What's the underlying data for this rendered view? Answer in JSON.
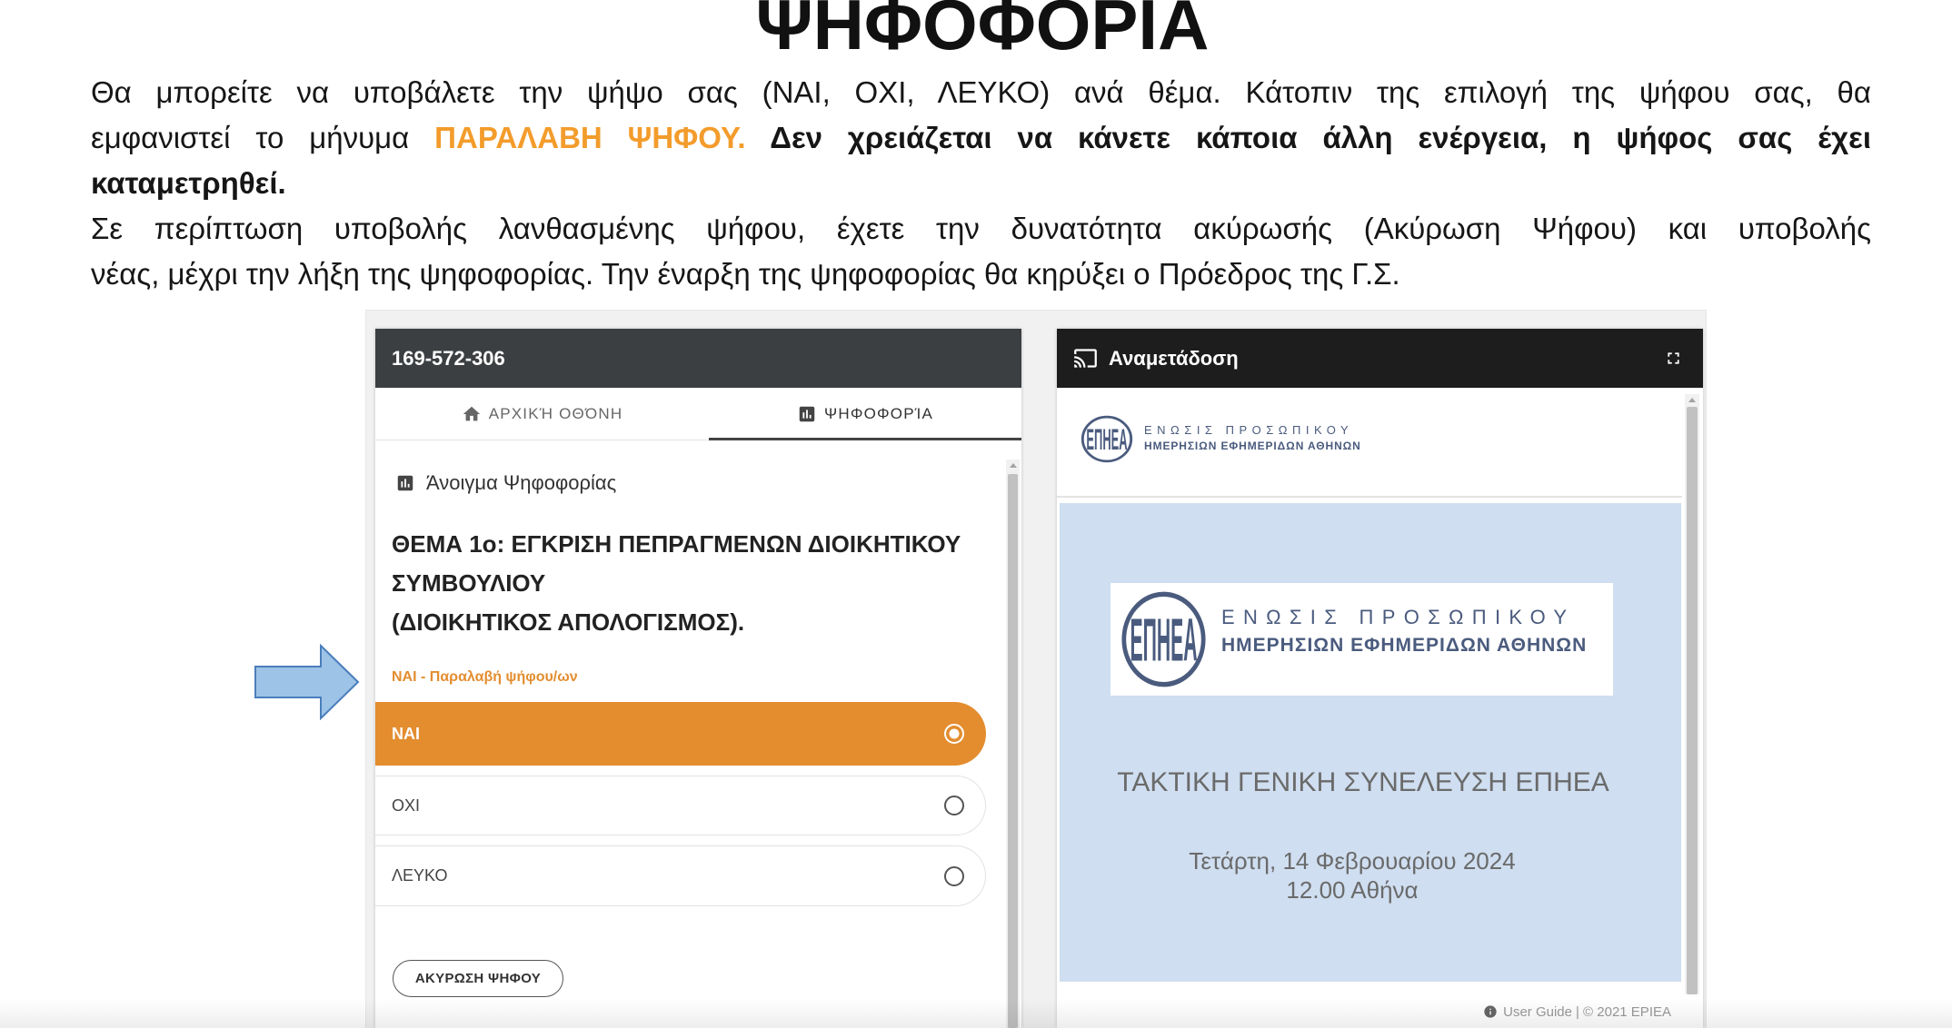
{
  "page": {
    "title": "ΨΗΦΟΦΟΡΙΑ"
  },
  "intro": {
    "line1": "Θα μπορείτε να υποβάλετε την ψήψο σας (ΝΑΙ, ΟΧΙ, ΛΕΥΚΟ) ανά θέμα. Κάτοπιν της επιλογή της ψήφου σας, θα",
    "line2_text": "εμφανιστεί το μήνυμα ",
    "line2_highlight": "ΠΑΡΑΛΑΒΗ ΨΗΦΟΥ.",
    "line2_bold": " Δεν χρειάζεται να κάνετε κάποια άλλη ενέργεια, η ψήφος σας έχει",
    "line3_bold": "καταμετρηθεί.",
    "line4": "Σε περίπτωση υποβολής λανθασμένης ψήφου, έχετε την δυνατότητα ακύρωσής (Ακύρωση Ψήφου) και υποβολής",
    "line5": "νέας, μέχρι την λήξη της ψηφοφορίας. Την έναρξη της ψηφοφορίας θα κηρύξει ο Πρόεδρος της Γ.Σ."
  },
  "pointer_arrow": {
    "icon": "right-arrow-icon"
  },
  "voting_panel": {
    "header_id": "169-572-306",
    "tabs": [
      {
        "label": "ΑΡΧΙΚΉ ΟΘΌΝΗ",
        "icon": "home-icon",
        "active": false
      },
      {
        "label": "ΨΗΦΟΦΟΡΊΑ",
        "icon": "bar-chart-icon",
        "active": true
      }
    ],
    "section_icon": "bar-chart-icon",
    "section_title": "Άνοιγμα Ψηφοφορίας",
    "topic_title": "ΘΕΜΑ 1ο: ΕΓΚΡΙΣΗ ΠΕΠΡΑΓΜΕΝΩΝ ΔΙΟΙΚΗΤΙΚΟΥ ΣΥΜΒΟΥΛΙΟΥ",
    "topic_subtitle": "(ΔΙΟΙΚΗΤΙΚΟΣ ΑΠΟΛΟΓΙΣΜΟΣ).",
    "receipt_message": "ΝΑΙ - Παραλαβή ψήφου/ων",
    "options": [
      {
        "label": "ΝΑΙ",
        "selected": true
      },
      {
        "label": "ΟΧΙ",
        "selected": false
      },
      {
        "label": "ΛΕΥΚΟ",
        "selected": false
      }
    ],
    "cancel_button": "ΑΚΥΡΩΣΗ ΨΗΦΟΥ"
  },
  "broadcast_panel": {
    "header_icon": "cast-icon",
    "header_title": "Αναμετάδοση",
    "fullscreen_icon": "fullscreen-icon",
    "logo": {
      "monogram": "ΕΠΗΕΑ",
      "line1": "ΕΝΩΣΙΣ ΠΡΟΣΩΠΙΚΟΥ",
      "line2": "ΗΜΕΡΗΣΙΩΝ ΕΦΗΜΕΡΙΔΩΝ ΑΘΗΝΩΝ"
    },
    "slide": {
      "title": "ΤΑΚΤΙΚΗ ΓΕΝΙΚΗ ΣΥΝΕΛΕΥΣΗ ΕΠΗΕΑ",
      "date": "Τετάρτη, 14 Φεβρουαρίου 2024",
      "time_place": "12.00 Αθήνα"
    },
    "footer": {
      "icon": "info-icon",
      "user_guide": "User Guide",
      "copyright": "| © 2021 EPIEA"
    }
  },
  "colors": {
    "accent_orange": "#e38d2f",
    "highlight_orange": "#f39c2c",
    "arrow_fill": "#9dc3e6",
    "arrow_stroke": "#4a7ebb",
    "voting_header": "#3c3f41",
    "broadcast_header": "#1d1d1d",
    "slide_background": "#cfdef0",
    "logo_blue": "#4a5b7e"
  }
}
